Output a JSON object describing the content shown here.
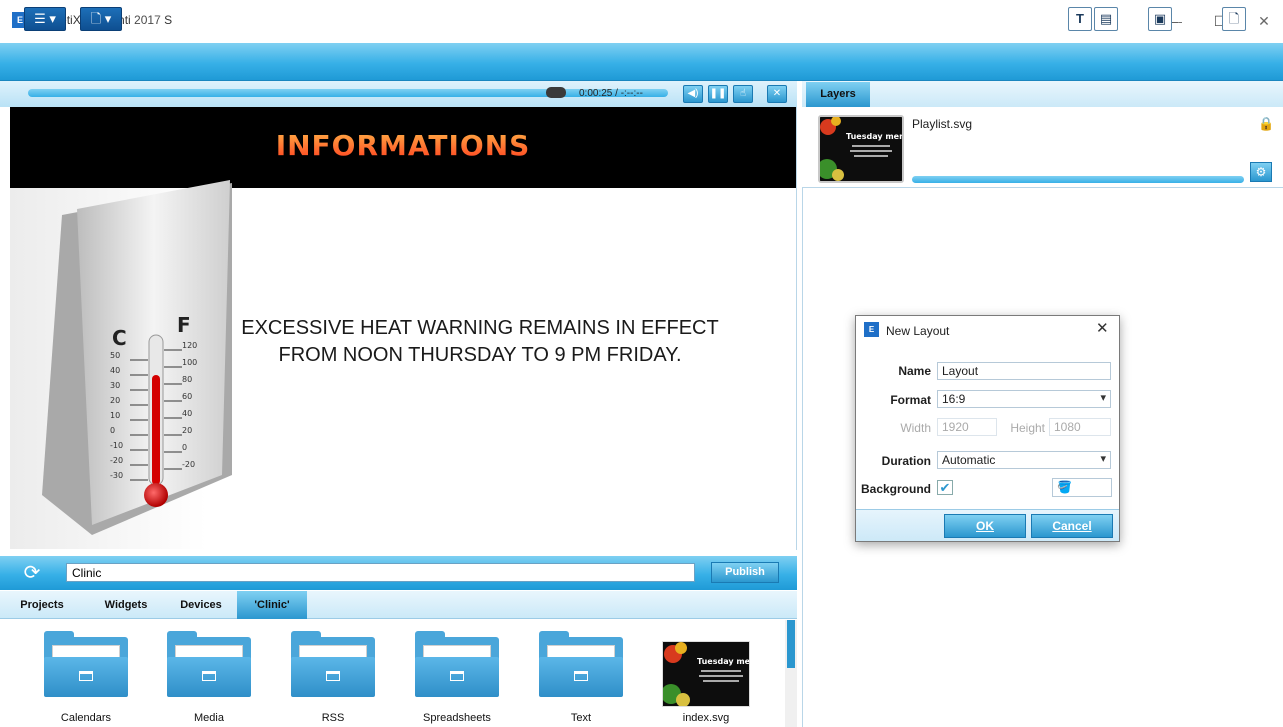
{
  "app": {
    "title": "SpinetiX Elementi 2017 S",
    "logo_text": "E",
    "window_controls": {
      "minimize": "—",
      "maximize": "☐",
      "close": "✕"
    }
  },
  "preview": {
    "timecode": "0:00:25 / -:--:--",
    "slide": {
      "title": "INFORMATIONS",
      "message": "EXCESSIVE HEAT WARNING REMAINS IN EFFECT FROM NOON THURSDAY TO 9 PM FRIDAY.",
      "thermometer": {
        "unit_c": "C",
        "unit_f": "F",
        "c_ticks": [
          "50",
          "40",
          "30",
          "20",
          "10",
          "0",
          "-10",
          "-20",
          "-30"
        ],
        "f_ticks": [
          "120",
          "100",
          "80",
          "60",
          "40",
          "20",
          "0",
          "-20"
        ]
      }
    }
  },
  "library": {
    "search_value": "Clinic",
    "publish_label": "Publish",
    "tabs": [
      "Projects",
      "Widgets",
      "Devices",
      "'Clinic'"
    ],
    "active_tab": "'Clinic'",
    "items": [
      "Calendars",
      "Media",
      "RSS",
      "Spreadsheets",
      "Text",
      "index.svg"
    ],
    "thumb_title": "Tuesday menu"
  },
  "layers": {
    "tab_label": "Layers",
    "item": {
      "name": "Playlist.svg",
      "thumb_title": "Tuesday menu"
    }
  },
  "dialog": {
    "title": "New Layout",
    "close": "✕",
    "name_label": "Name",
    "name_value": "Layout",
    "format_label": "Format",
    "format_value": "16:9",
    "width_label": "Width",
    "width_value": "1920",
    "height_label": "Height",
    "height_value": "1080",
    "duration_label": "Duration",
    "duration_value": "Automatic",
    "background_label": "Background",
    "background_checked": true,
    "ok_label": "OK",
    "cancel_label": "Cancel"
  },
  "colors": {
    "toolbar_blue": "#37b0e7",
    "slide_title": "#ff6b2a"
  }
}
